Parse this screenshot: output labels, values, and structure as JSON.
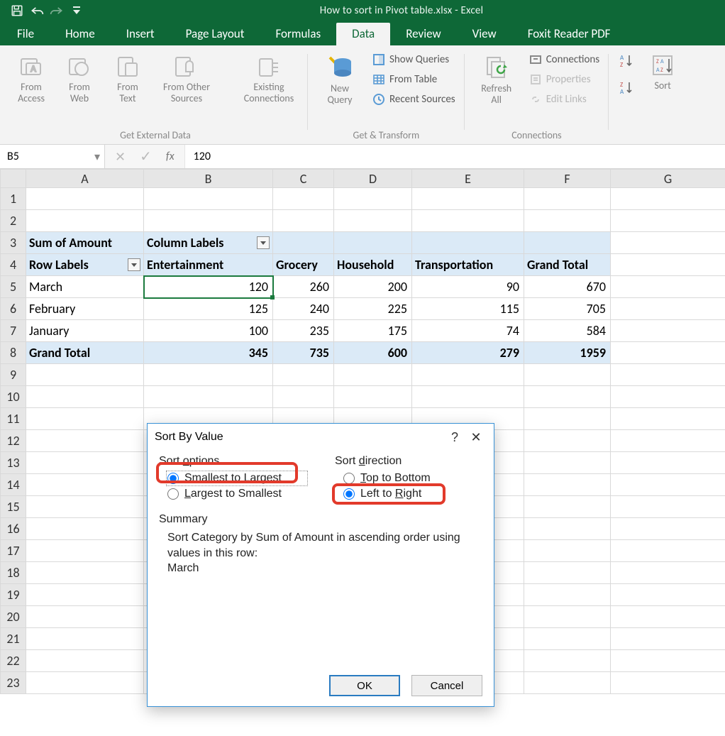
{
  "window": {
    "title": "How to sort in Pivot table.xlsx - Excel"
  },
  "tabs": {
    "file": "File",
    "home": "Home",
    "insert": "Insert",
    "pageLayout": "Page Layout",
    "formulas": "Formulas",
    "data": "Data",
    "review": "Review",
    "view": "View",
    "foxit": "Foxit Reader PDF"
  },
  "ribbon": {
    "getExternal": {
      "title": "Get External Data",
      "fromAccess": "From\nAccess",
      "fromWeb": "From\nWeb",
      "fromText": "From\nText",
      "fromOther": "From Other\nSources",
      "existing": "Existing\nConnections"
    },
    "getTransform": {
      "title": "Get & Transform",
      "newQuery": "New\nQuery",
      "showQueries": "Show Queries",
      "fromTable": "From Table",
      "recent": "Recent Sources"
    },
    "connections": {
      "title": "Connections",
      "refresh": "Refresh\nAll",
      "conn": "Connections",
      "props": "Properties",
      "edit": "Edit Links"
    },
    "sort": {
      "sort": "Sort"
    }
  },
  "formulaBar": {
    "nameBox": "B5",
    "fx": "fx",
    "value": "120"
  },
  "columns": [
    "A",
    "B",
    "C",
    "D",
    "E",
    "F",
    "G"
  ],
  "pivot": {
    "corner": "Sum of Amount",
    "colLabels": "Column Labels",
    "rowLabels": "Row Labels",
    "cats": [
      "Entertainment",
      "Grocery",
      "Household",
      "Transportation",
      "Grand Total"
    ],
    "rows": [
      {
        "label": "March",
        "vals": [
          120,
          260,
          200,
          90,
          670
        ]
      },
      {
        "label": "February",
        "vals": [
          125,
          240,
          225,
          115,
          705
        ]
      },
      {
        "label": "January",
        "vals": [
          100,
          235,
          175,
          74,
          584
        ]
      }
    ],
    "grand": {
      "label": "Grand Total",
      "vals": [
        345,
        735,
        600,
        279,
        1959
      ]
    }
  },
  "dialog": {
    "title": "Sort By Value",
    "help": "?",
    "sortOptions": "Sort options",
    "smallest": "Smallest to Largest",
    "largest": "Largest to Smallest",
    "sortDirection": "Sort direction",
    "topBottom": "Top to Bottom",
    "leftRight": "Left to Right",
    "summary": "Summary",
    "summaryText": "Sort Category by Sum of Amount in ascending order using values in this row:\nMarch",
    "ok": "OK",
    "cancel": "Cancel"
  }
}
